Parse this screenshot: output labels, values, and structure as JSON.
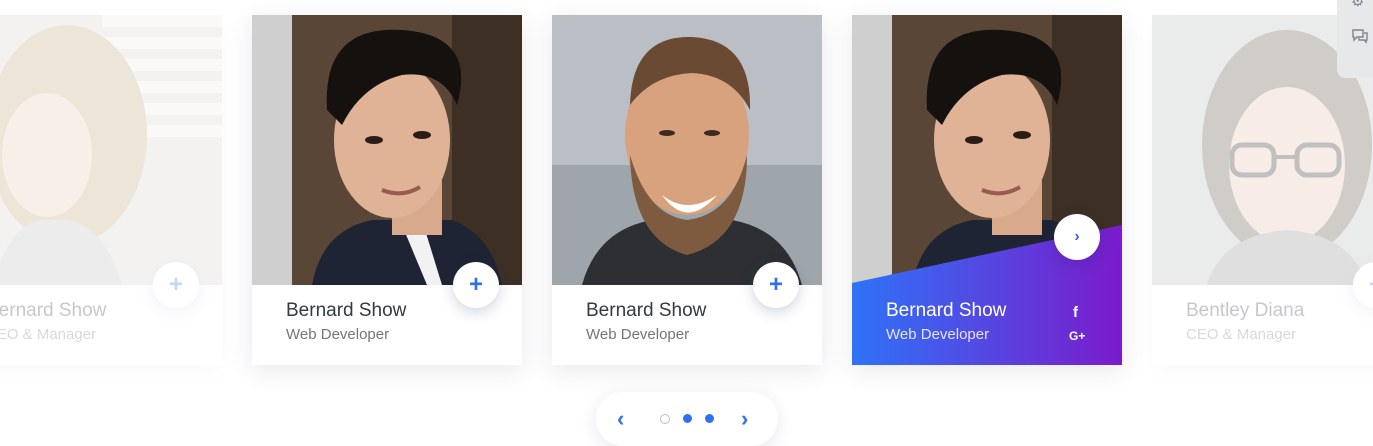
{
  "team": {
    "cards": [
      {
        "name": "Bernard Show",
        "role": "CEO & Manager",
        "photo_icon": "woman-portrait-photo",
        "state": "faded"
      },
      {
        "name": "Bernard Show",
        "role": "Web Developer",
        "photo_icon": "young-man-portrait-photo",
        "state": "normal"
      },
      {
        "name": "Bernard Show",
        "role": "Web Developer",
        "photo_icon": "bearded-man-portrait-photo",
        "state": "normal"
      },
      {
        "name": "Bernard Show",
        "role": "Web Developer",
        "photo_icon": "young-man-portrait-photo",
        "state": "active"
      },
      {
        "name": "Bentley Diana",
        "role": "CEO & Manager",
        "photo_icon": "woman-glasses-portrait-photo",
        "state": "faded"
      }
    ],
    "expand_button_symbol": "+",
    "active_arrow_symbol": "›",
    "social": {
      "facebook": "f",
      "google_plus": "G+"
    }
  },
  "pagination": {
    "prev_symbol": "‹",
    "next_symbol": "›",
    "dot_count": 3,
    "active_dots": [
      2,
      3
    ]
  },
  "side_widget": {
    "icons": [
      "settings-icon",
      "chat-icon"
    ]
  },
  "colors": {
    "accent": "#2f6ff0",
    "gradient_start": "#2e73f7",
    "gradient_end": "#7b1bcb",
    "name_text": "#333a44",
    "role_text": "#6f7680"
  }
}
